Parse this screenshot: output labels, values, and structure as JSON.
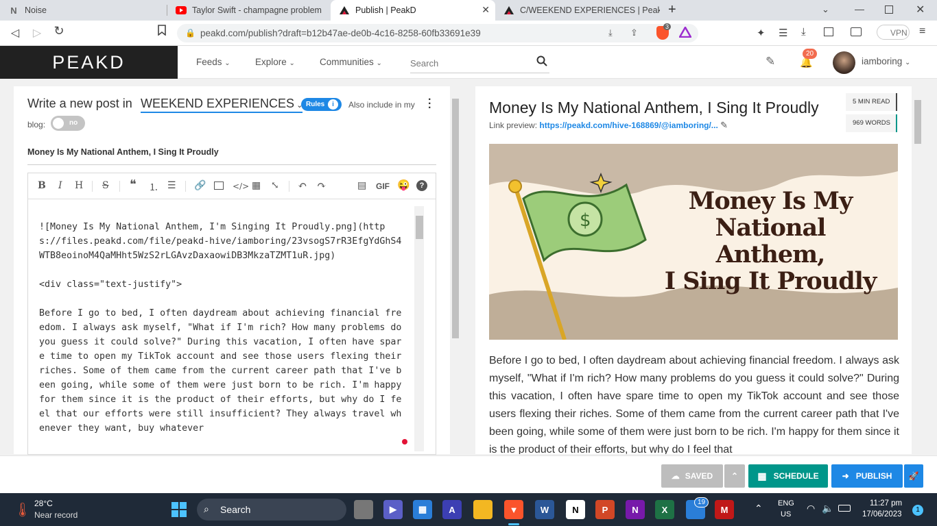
{
  "tabs": [
    {
      "label": "Noise",
      "icon": "noise-icon"
    },
    {
      "label": "Taylor Swift - champagne problem",
      "icon": "youtube-icon"
    },
    {
      "label": "Publish | PeakD",
      "icon": "peakd-icon",
      "active": true
    },
    {
      "label": "C/WEEKEND EXPERIENCES | PeakD",
      "icon": "peakd-icon"
    }
  ],
  "address": {
    "url": "peakd.com/publish?draft=b12b47ae-de0b-4c16-8258-60fb33691e39",
    "vpn": "VPN",
    "shield_count": "3"
  },
  "header": {
    "logo": "PEAKD",
    "menu": [
      "Feeds",
      "Explore",
      "Communities"
    ],
    "search_placeholder": "Search",
    "notif_count": "20",
    "username": "iamboring"
  },
  "compose": {
    "prefix": "Write a new post in",
    "community": "WEEKEND EXPERIENCES",
    "rules_label": "Rules",
    "also_label": "Also include in my",
    "blog_label": "blog:",
    "toggle_label": "no",
    "title_value": "Money Is My National Anthem, I Sing It Proudly",
    "gif_label": "GIF",
    "body_text": "![Money Is My National Anthem, I'm Singing It Proudly.png](https://files.peakd.com/file/peakd-hive/iamboring/23vsogS7rR3EfgYdGhS4WTB8eoinoM4QaMHht5WzS2rLGAvzDaxaowiDB3MkzaTZMT1uR.jpg)\n\n<div class=\"text-justify\">\n\nBefore I go to bed, I often daydream about achieving financial freedom. I always ask myself, \"What if I'm rich? How many problems do you guess it could solve?\" During this vacation, I often have spare time to open my TikTok account and see those users flexing their riches. Some of them came from the current career path that I've been going, while some of them were just born to be rich. I'm happy for them since it is the product of their efforts, but why do I feel that our efforts were still insufficient? They always travel whenever they want, buy whatever"
  },
  "preview": {
    "title": "Money Is My National Anthem, I Sing It Proudly",
    "read_time": "5 MIN READ",
    "words": "969 WORDS",
    "link_label": "Link preview:",
    "link_url": "https://peakd.com/hive-168869/@iamboring/...",
    "image_text": [
      "Money Is My",
      "National Anthem,",
      "I Sing It Proudly"
    ],
    "body": "Before I go to bed, I often daydream about achieving financial freedom. I always ask myself, \"What if I'm rich? How many problems do you guess it could solve?\" During this vacation, I often have spare time to open my TikTok account and see those users flexing their riches. Some of them came from the current career path that I've been going, while some of them were just born to be rich. I'm happy for them since it is the product of their efforts, but why do I feel that"
  },
  "actions": {
    "saved": "SAVED",
    "schedule": "SCHEDULE",
    "publish": "PUBLISH"
  },
  "taskbar": {
    "temp": "28°C",
    "weather": "Near record",
    "search": "Search",
    "lang1": "ENG",
    "lang2": "US",
    "time": "11:27 pm",
    "date": "17/06/2023",
    "badge": "19",
    "notif": "1"
  },
  "colors": {
    "accent": "#1e88e5",
    "teal": "#00968a",
    "dark": "#212121",
    "peak_red": "#e31337"
  }
}
